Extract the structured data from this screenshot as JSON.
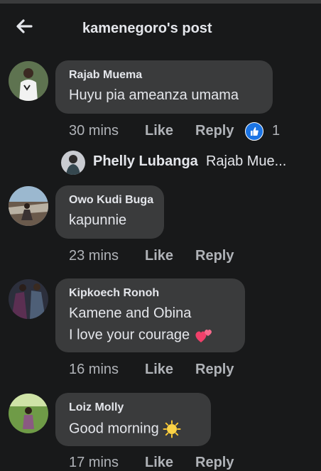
{
  "header": {
    "title": "kamenegoro's post",
    "back_icon": "arrow-left-icon"
  },
  "comments": [
    {
      "name": "Rajab Muema",
      "lines": [
        "Huyu pia ameanza umama"
      ],
      "time": "30 mins",
      "like": "Like",
      "reply": "Reply",
      "reaction_count": "1"
    },
    {
      "name": "Owo Kudi Buga",
      "lines": [
        "kapunnie"
      ],
      "time": "23 mins",
      "like": "Like",
      "reply": "Reply"
    },
    {
      "name": "Kipkoech Ronoh",
      "lines": [
        "Kamene and Obina",
        "I love your courage"
      ],
      "time": "16 mins",
      "like": "Like",
      "reply": "Reply"
    },
    {
      "name": "Loiz Molly",
      "lines": [
        "Good morning"
      ],
      "time": "17 mins",
      "like": "Like",
      "reply": "Reply"
    }
  ],
  "reply_preview": {
    "name": "Phelly Lubanga",
    "text": "Rajab Mue..."
  },
  "colors": {
    "background": "#18191a",
    "bubble": "#3a3b3c",
    "meta": "#b0b3b8",
    "like_blue": "#1b74e4"
  }
}
